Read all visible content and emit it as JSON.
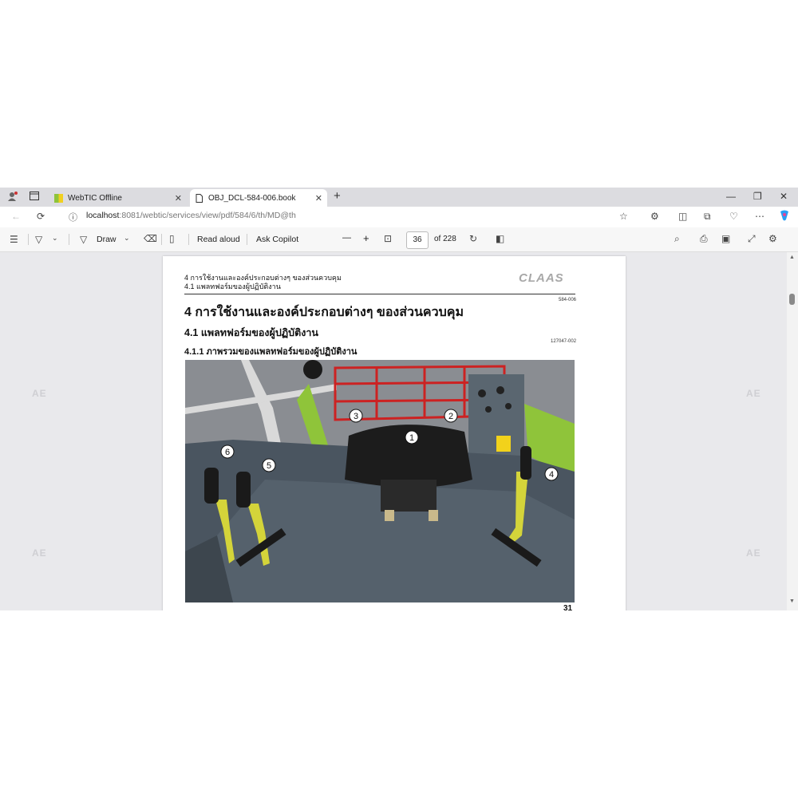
{
  "tabs": [
    {
      "title": "WebTIC Offline",
      "close": "✕"
    },
    {
      "title": "OBJ_DCL-584-006.book",
      "close": "✕"
    }
  ],
  "new_tab": "+",
  "window_controls": {
    "minimize": "—",
    "maximize": "❐",
    "close": "✕"
  },
  "address": {
    "host": "localhost",
    "path": ":8081/webtic/services/view/pdf/584/6/th/MD@th"
  },
  "pdf_toolbar": {
    "draw_label": "Draw",
    "read_aloud_label": "Read aloud",
    "ask_copilot_label": "Ask Copilot",
    "zoom_out": "—",
    "zoom_in": "+",
    "page_current": "36",
    "page_total": "of 228"
  },
  "watermark": "AE",
  "document": {
    "running_head_1": "4 การใช้งานและองค์ประกอบต่างๆ ของส่วนควบคุม",
    "running_head_2": "4.1 แพลทฟอร์มของผู้ปฏิบัติงาน",
    "logo": "CLAAS",
    "doc_code": "584-006",
    "heading_1": "4 การใช้งานและองค์ประกอบต่างๆ ของส่วนควบคุม",
    "heading_2": "4.1 แพลทฟอร์มของผู้ปฏิบัติงาน",
    "figure_code": "127047-002",
    "heading_3": "4.1.1 ภาพรวมของแพลทฟอร์มของผู้ปฏิบัติงาน",
    "callouts": [
      "1",
      "2",
      "3",
      "4",
      "5",
      "6"
    ],
    "page_number": "31"
  },
  "colors": {
    "tabbar": "#dcdce0",
    "viewer_bg": "#e9e9ec",
    "platform": "#4a5560",
    "rails": "#cc2222",
    "levers": "#d4d43a",
    "green": "#8fc43a"
  }
}
